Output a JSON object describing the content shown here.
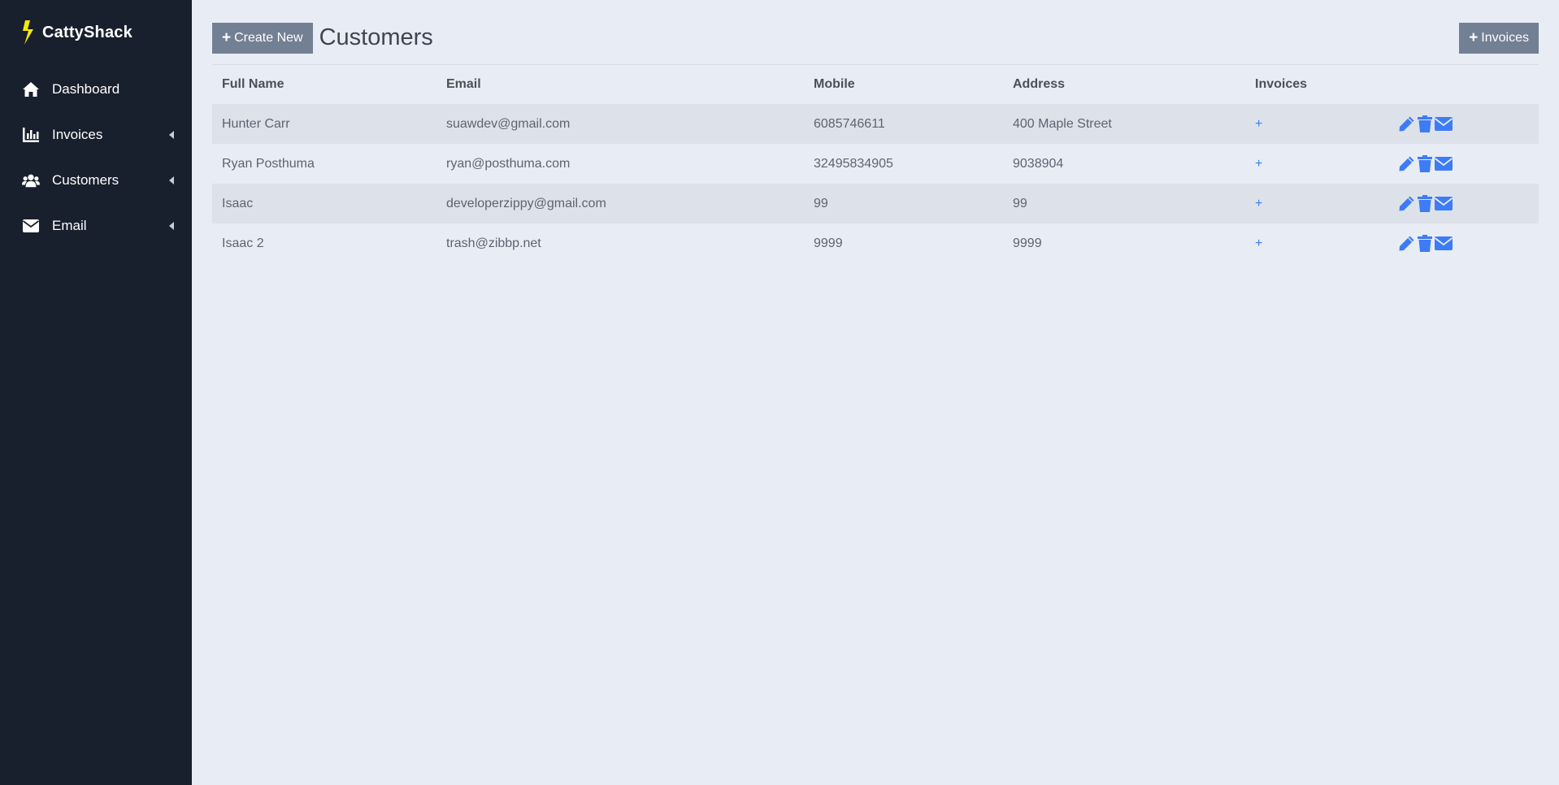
{
  "brand": {
    "name": "CattyShack",
    "icon": "lightning-bolt-icon",
    "icon_color": "#f5e90a"
  },
  "sidebar": {
    "items": [
      {
        "label": "Dashboard",
        "icon": "home-icon",
        "has_submenu": false
      },
      {
        "label": "Invoices",
        "icon": "bar-chart-icon",
        "has_submenu": true
      },
      {
        "label": "Customers",
        "icon": "users-icon",
        "has_submenu": true
      },
      {
        "label": "Email",
        "icon": "envelope-icon",
        "has_submenu": true
      }
    ]
  },
  "header": {
    "create_button_label": "Create New",
    "title": "Customers",
    "invoices_button_label": "Invoices"
  },
  "table": {
    "columns": [
      "Full Name",
      "Email",
      "Mobile",
      "Address",
      "Invoices",
      ""
    ],
    "rows": [
      {
        "name": "Hunter Carr",
        "email": "suawdev@gmail.com",
        "mobile": "6085746611",
        "address": "400 Maple Street",
        "invoices": "+"
      },
      {
        "name": "Ryan Posthuma",
        "email": "ryan@posthuma.com",
        "mobile": "32495834905",
        "address": "9038904",
        "invoices": "+"
      },
      {
        "name": "Isaac",
        "email": "developerzippy@gmail.com",
        "mobile": "99",
        "address": "99",
        "invoices": "+"
      },
      {
        "name": "Isaac 2",
        "email": "trash@zibbp.net",
        "mobile": "9999",
        "address": "9999",
        "invoices": "+"
      }
    ],
    "row_actions": [
      "edit-icon",
      "delete-icon",
      "email-icon"
    ]
  },
  "colors": {
    "sidebar_bg": "#181f2d",
    "main_bg": "#e8edf5",
    "row_stripe": "#dde2ea",
    "button_bg": "#737f93",
    "accent_blue": "#3d7cf5"
  }
}
